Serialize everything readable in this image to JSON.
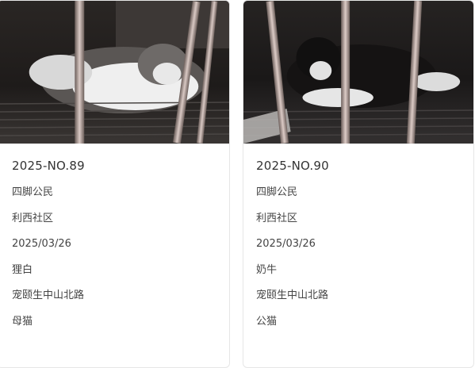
{
  "cards": [
    {
      "title": "2025-NO.89",
      "category": "四脚公民",
      "community": "利西社区",
      "date": "2025/03/26",
      "color": "狸白",
      "place": "宠颐生中山北路",
      "gender": "母猫"
    },
    {
      "title": "2025-NO.90",
      "category": "四脚公民",
      "community": "利西社区",
      "date": "2025/03/26",
      "color": "奶牛",
      "place": "宠颐生中山北路",
      "gender": "公猫"
    }
  ]
}
